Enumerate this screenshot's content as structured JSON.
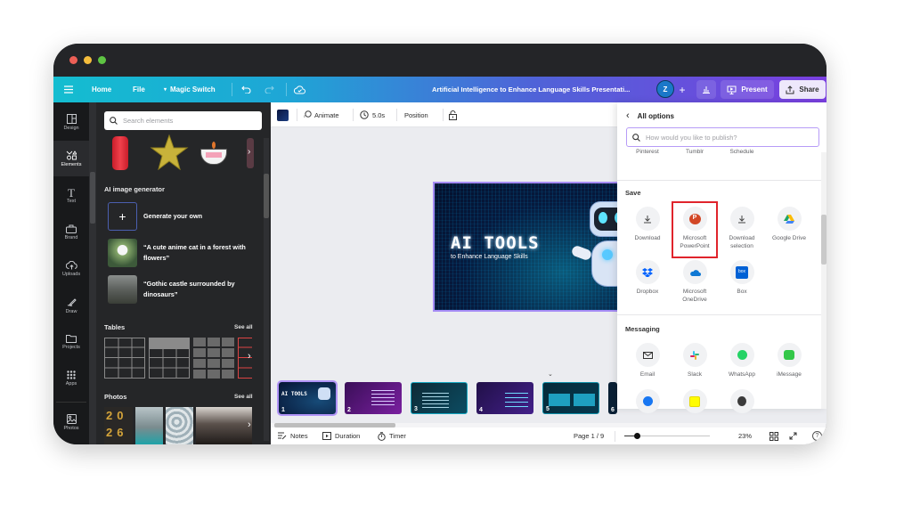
{
  "window": {
    "traffic_lights": {
      "close": "#ed5f56",
      "minimize": "#f5bd3c",
      "maximize": "#5ec443"
    }
  },
  "topbar": {
    "menu_icon": "hamburger-icon",
    "home": "Home",
    "file": "File",
    "magic_switch": "Magic Switch",
    "undo_icon": "undo-icon",
    "redo_icon": "redo-icon",
    "cloud_icon": "cloud-saved-icon",
    "doc_title": "Artificial Intelligence to Enhance Language Skills Presentati...",
    "avatar_initial": "Z",
    "add_icon": "plus-icon",
    "insights_icon": "bar-chart-icon",
    "present": "Present",
    "share": "Share"
  },
  "rail": {
    "items": [
      {
        "label": "Design",
        "icon": "design-icon"
      },
      {
        "label": "Elements",
        "icon": "elements-icon",
        "active": true
      },
      {
        "label": "Text",
        "icon": "text-icon"
      },
      {
        "label": "Brand",
        "icon": "brand-icon"
      },
      {
        "label": "Uploads",
        "icon": "upload-icon"
      },
      {
        "label": "Draw",
        "icon": "draw-icon"
      },
      {
        "label": "Projects",
        "icon": "folder-icon"
      },
      {
        "label": "Apps",
        "icon": "apps-icon"
      },
      {
        "label": "Photos",
        "icon": "photos-icon"
      }
    ]
  },
  "elements_panel": {
    "search_placeholder": "Search elements",
    "ai_section": {
      "title": "AI image generator",
      "generate": "Generate your own",
      "prompts": [
        "“A cute anime cat in a forest with flowers”",
        "“Gothic castle surrounded by dinosaurs”"
      ]
    },
    "tables": {
      "title": "Tables",
      "see_all": "See all"
    },
    "photos": {
      "title": "Photos",
      "see_all": "See all"
    }
  },
  "canvas_toolbar": {
    "color_swatch": "#0a1640",
    "animate": "Animate",
    "duration": "5.0s",
    "position": "Position",
    "lock_icon": "lock-icon"
  },
  "slide": {
    "title": "AI TOOLS",
    "subtitle": "to Enhance Language Skills"
  },
  "thumbnails": [
    "1",
    "2",
    "3",
    "4",
    "5",
    "6"
  ],
  "footer": {
    "notes": "Notes",
    "duration": "Duration",
    "timer": "Timer",
    "page": "Page 1 / 9",
    "zoom_percent": 23,
    "zoom_label": "23%"
  },
  "share_panel": {
    "back": "All options",
    "search_placeholder": "How would you like to publish?",
    "social_partial": [
      "Pinterest",
      "Tumblr",
      "Schedule"
    ],
    "save_title": "Save",
    "save_options": [
      "Download",
      "Microsoft PowerPoint",
      "Download selection",
      "Google Drive",
      "Dropbox",
      "Microsoft OneDrive",
      "Box"
    ],
    "highlighted_option": "Microsoft PowerPoint",
    "messaging_title": "Messaging",
    "messaging_options": [
      "Email",
      "Slack",
      "WhatsApp",
      "iMessage"
    ]
  }
}
